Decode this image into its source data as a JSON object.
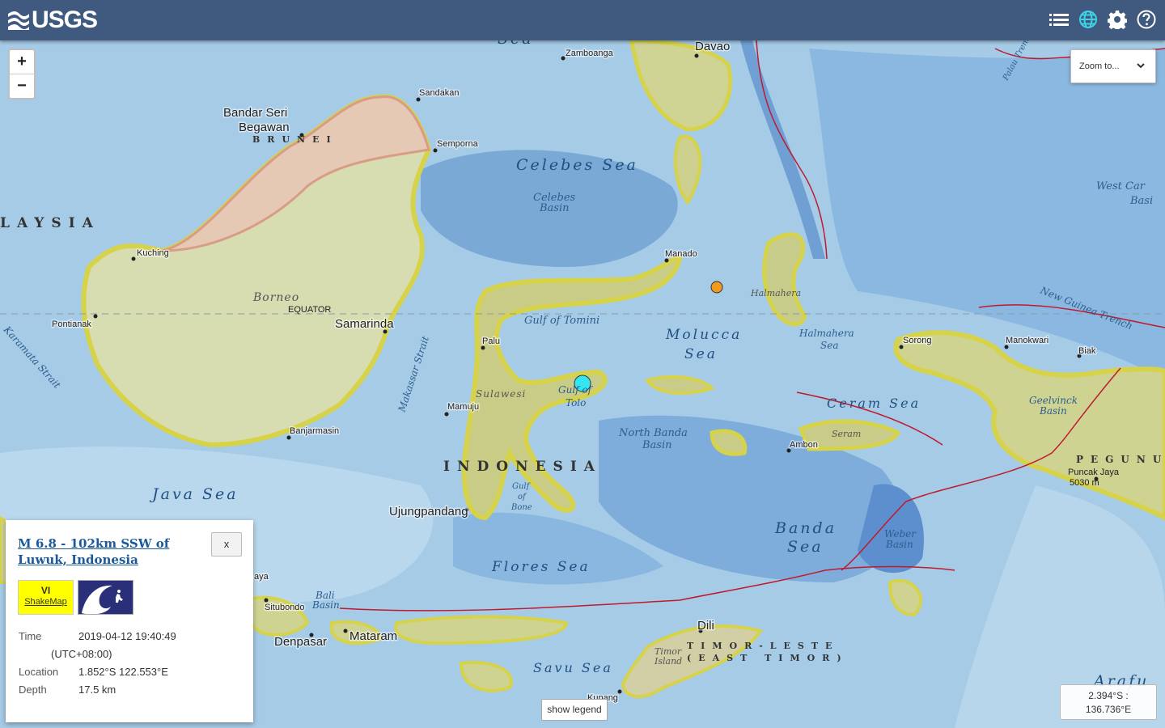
{
  "header": {
    "logo_text": "USGS"
  },
  "icons": {
    "list": "list-icon",
    "globe": "globe-icon",
    "settings": "gear-icon",
    "help": "help-icon"
  },
  "zoom": {
    "in_label": "+",
    "out_label": "−",
    "to_label": "Zoom to..."
  },
  "map": {
    "seas": {
      "celebes_sea": "Celebes Sea",
      "celebes_basin_1": "Celebes",
      "celebes_basin_2": "Basin",
      "molucca_1": "Molucca",
      "molucca_2": "Sea",
      "halmahera_sea_1": "Halmahera",
      "halmahera_sea_2": "Sea",
      "ceram_sea": "Ceram Sea",
      "java_sea": "Java Sea",
      "flores_sea": "Flores Sea",
      "banda_1": "Banda",
      "banda_2": "Sea",
      "savu_sea": "Savu Sea",
      "arafura": "Arafu",
      "gulf_tomini": "Gulf of Tomini",
      "gulf_tolo_1": "Gulf of",
      "gulf_tolo_2": "Tolo",
      "gulf_bone_1": "Gulf",
      "gulf_bone_2": "of",
      "gulf_bone_3": "Bone",
      "north_banda_1": "North Banda",
      "north_banda_2": "Basin",
      "weber_1": "Weber",
      "weber_2": "Basin",
      "bali_basin_1": "Bali",
      "bali_basin_2": "Basin",
      "geelvinck_1": "Geelvinck",
      "geelvinck_2": "Basin",
      "west_car_1": "West Car",
      "west_car_2": "Basi",
      "makassar": "Makassar Strait",
      "karamata": "Karamata Strait",
      "new_guinea_trench": "New Guinea Trench",
      "sea_top": "Sea",
      "palau_trench": "Palau Trench"
    },
    "countries": {
      "malaysia": "LAYSIA",
      "indonesia": "INDONESIA",
      "brunei": "BRUNEI",
      "timor_1": "TIMOR-LESTE",
      "timor_2": "(EAST TIMOR)",
      "png": "PEGUNU"
    },
    "land": {
      "borneo": "Borneo",
      "equator": "EQUATOR",
      "sulawesi": "Sulawesi",
      "halmahera": "Halmahera",
      "seram": "Seram",
      "timor_1": "Timor",
      "timor_2": "Island",
      "puncak": "Puncak Jaya",
      "puncak_h": "5030 m"
    },
    "cities": {
      "zamboanga": "Zamboanga",
      "davao": "Davao",
      "sandakan": "Sandakan",
      "bandar_1": "Bandar Seri",
      "bandar_2": "Begawan",
      "semporna": "Semporna",
      "kuching": "Kuching",
      "manado": "Manado",
      "pontianak": "Pontianak",
      "samarinda": "Samarinda",
      "palu": "Palu",
      "mamuju": "Mamuju",
      "banjarmasin": "Banjarmasin",
      "sorong": "Sorong",
      "manokwari": "Manokwari",
      "biak": "Biak",
      "ambon": "Ambon",
      "ujungpandang": "Ujungpandang",
      "situbondo": "Situbondo",
      "denpasar": "Denpasar",
      "mataram": "Mataram",
      "dili": "Dili",
      "kupang": "Kupang",
      "aya": "aya"
    }
  },
  "popup": {
    "title": "M 6.8 - 102km SSW of Luwuk, Indonesia",
    "close_label": "x",
    "shakemap_mmi": "VI",
    "shakemap_label": "ShakeMap",
    "tsunami_icon": "tsunami-icon",
    "shakemap_color": "#ffff00",
    "rows": [
      {
        "label": "Time",
        "value": "2019-04-12 19:40:49"
      },
      {
        "label": "",
        "value": "(UTC+08:00)"
      },
      {
        "label": "Location",
        "value": "1.852°S 122.553°E"
      },
      {
        "label": "Depth",
        "value": "17.5 km"
      }
    ]
  },
  "legend_button": "show legend",
  "coords": {
    "lat": "2.394°S :",
    "lon": "136.736°E"
  },
  "colors": {
    "header_bg": "#3f5a7e",
    "selected_event": "#33e6f2",
    "other_event": "#f29a1e",
    "plate_boundary": "#c0192f"
  }
}
